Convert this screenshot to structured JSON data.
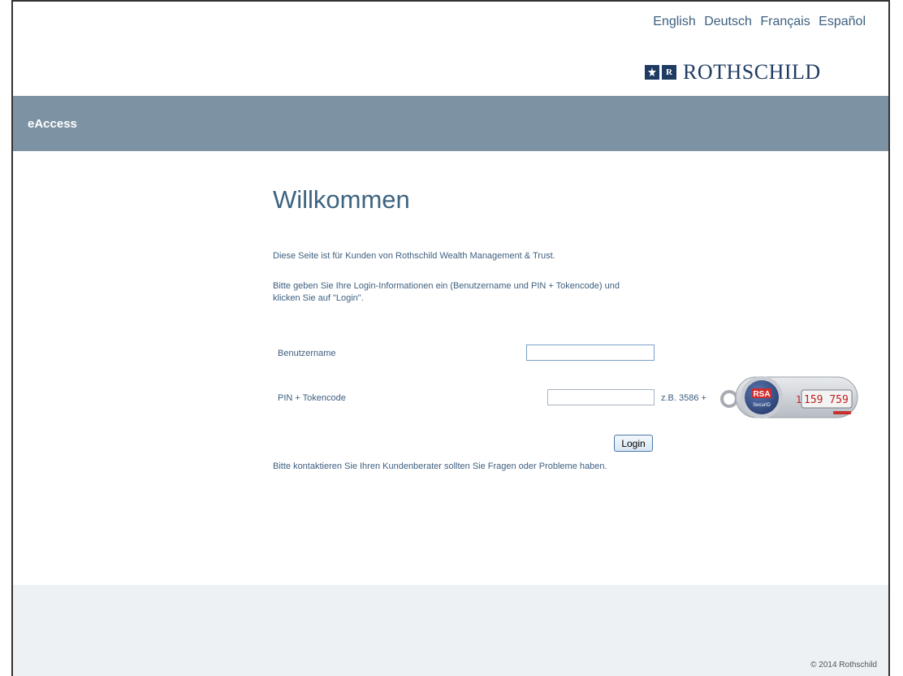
{
  "languages": [
    "English",
    "Deutsch",
    "Français",
    "Español"
  ],
  "logo": {
    "name": "ROTHSCHILD",
    "mark_right": "R"
  },
  "header": {
    "section_title": "eAccess"
  },
  "main": {
    "title": "Willkommen",
    "intro": "Diese Seite ist für Kunden von Rothschild Wealth Management & Trust.",
    "instructions": "Bitte geben Sie Ihre Login-Informationen ein (Benutzername und PIN + Tokencode) und klicken Sie auf \"Login\".",
    "username_label": "Benutzername",
    "username_value": "",
    "pin_label": "PIN + Tokencode",
    "pin_value": "",
    "pin_example": "z.B. 3586 +",
    "token": {
      "brand": "RSA",
      "product": "SecurID",
      "code": "159 759",
      "digit": "1"
    },
    "login_label": "Login",
    "contact_note": "Bitte kontaktieren Sie Ihren Kundenberater sollten Sie Fragen oder Probleme haben."
  },
  "footer": {
    "copyright": "© 2014 Rothschild"
  },
  "colors": {
    "banner": "#7d93a3",
    "text": "#3d5f7f",
    "footer_bg": "#eef1f4",
    "logo": "#1f3b63"
  }
}
